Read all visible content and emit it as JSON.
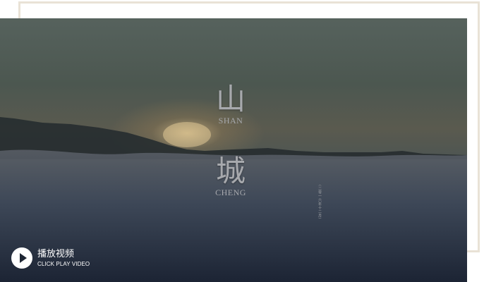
{
  "hero": {
    "title_char_1": "山",
    "title_latin_1": "SHAN",
    "title_char_2": "城",
    "title_latin_2": "CHENG",
    "vertical_note": "(二零一六年十二月)"
  },
  "play_button": {
    "label_cn": "播放视频",
    "label_en": "CLICK PLAY VIDEO",
    "icon": "play-icon"
  },
  "colors": {
    "frame_border": "#e9e2d6",
    "overlay_dark": "#1d2535",
    "play_icon_bg": "#ffffff"
  }
}
